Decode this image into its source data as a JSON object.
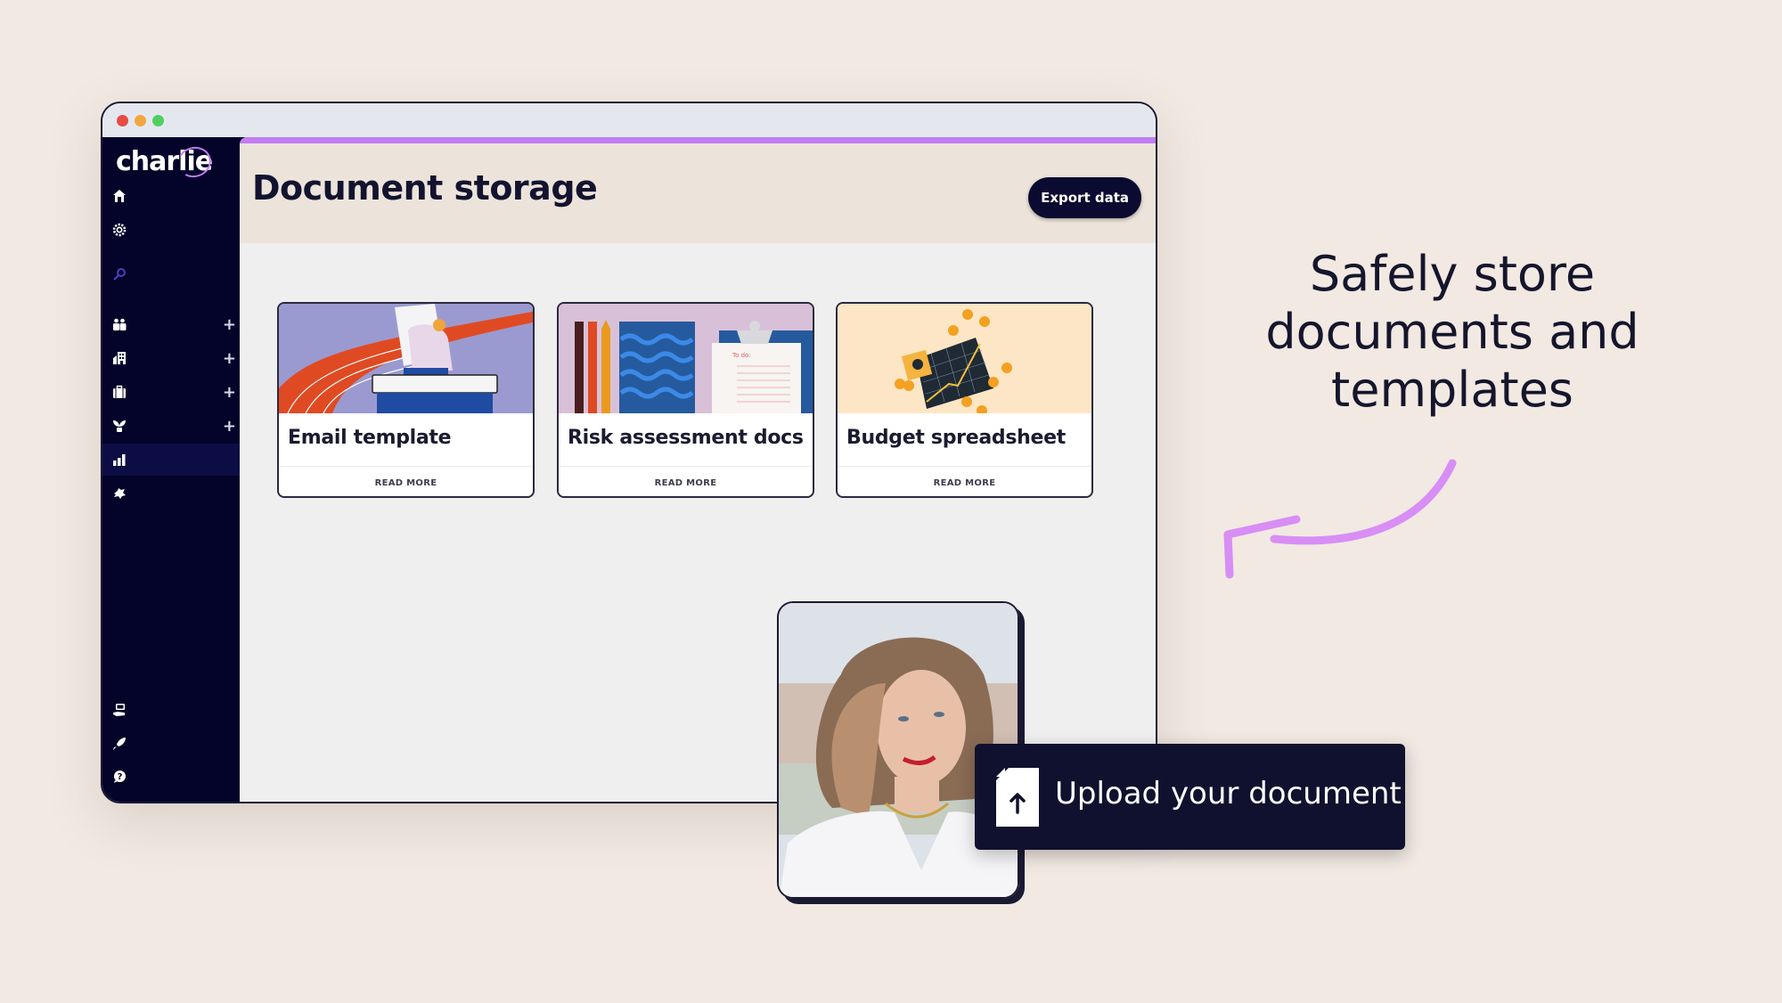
{
  "window": {
    "controls": [
      "close",
      "minimize",
      "maximize"
    ]
  },
  "brand": {
    "logo_text": "charlie",
    "accent_color": "#c27df2",
    "sidebar_color": "#04032a"
  },
  "sidebar": {
    "items": [
      {
        "icon": "home-icon",
        "glyph": "⌂",
        "has_plus": false
      },
      {
        "icon": "gear-icon",
        "glyph": "⚙",
        "has_plus": false
      },
      {
        "icon": "search-icon",
        "glyph": "⚲",
        "has_plus": false
      },
      {
        "icon": "people-icon",
        "glyph": "👥",
        "has_plus": true
      },
      {
        "icon": "building-icon",
        "glyph": "▦",
        "has_plus": true
      },
      {
        "icon": "briefcase-icon",
        "glyph": "💼",
        "has_plus": true
      },
      {
        "icon": "plant-icon",
        "glyph": "❦",
        "has_plus": true
      },
      {
        "icon": "bar-chart-icon",
        "glyph": "▮",
        "has_plus": false,
        "active": true
      },
      {
        "icon": "puzzle-icon",
        "glyph": "✱",
        "has_plus": false
      }
    ],
    "bottom_items": [
      {
        "icon": "computer-hand-icon",
        "glyph": "▭"
      },
      {
        "icon": "rocket-icon",
        "glyph": "➶"
      },
      {
        "icon": "help-icon",
        "glyph": "?"
      }
    ],
    "plus_label": "+"
  },
  "header": {
    "title": "Document storage",
    "export_label": "Export data"
  },
  "cards": [
    {
      "title": "Email template",
      "link": "READ MORE",
      "image": "illustration-person-reading-on-books"
    },
    {
      "title": "Risk assessment docs",
      "link": "READ MORE",
      "image": "illustration-pens-notebook-clipboard",
      "clipboard_text": "To do:"
    },
    {
      "title": "Budget spreadsheet",
      "link": "READ MORE",
      "image": "illustration-chart-with-coins"
    }
  ],
  "upload": {
    "label": "Upload your document"
  },
  "tagline": {
    "line1": "Safely store",
    "line2": "documents and",
    "line3": "templates"
  }
}
